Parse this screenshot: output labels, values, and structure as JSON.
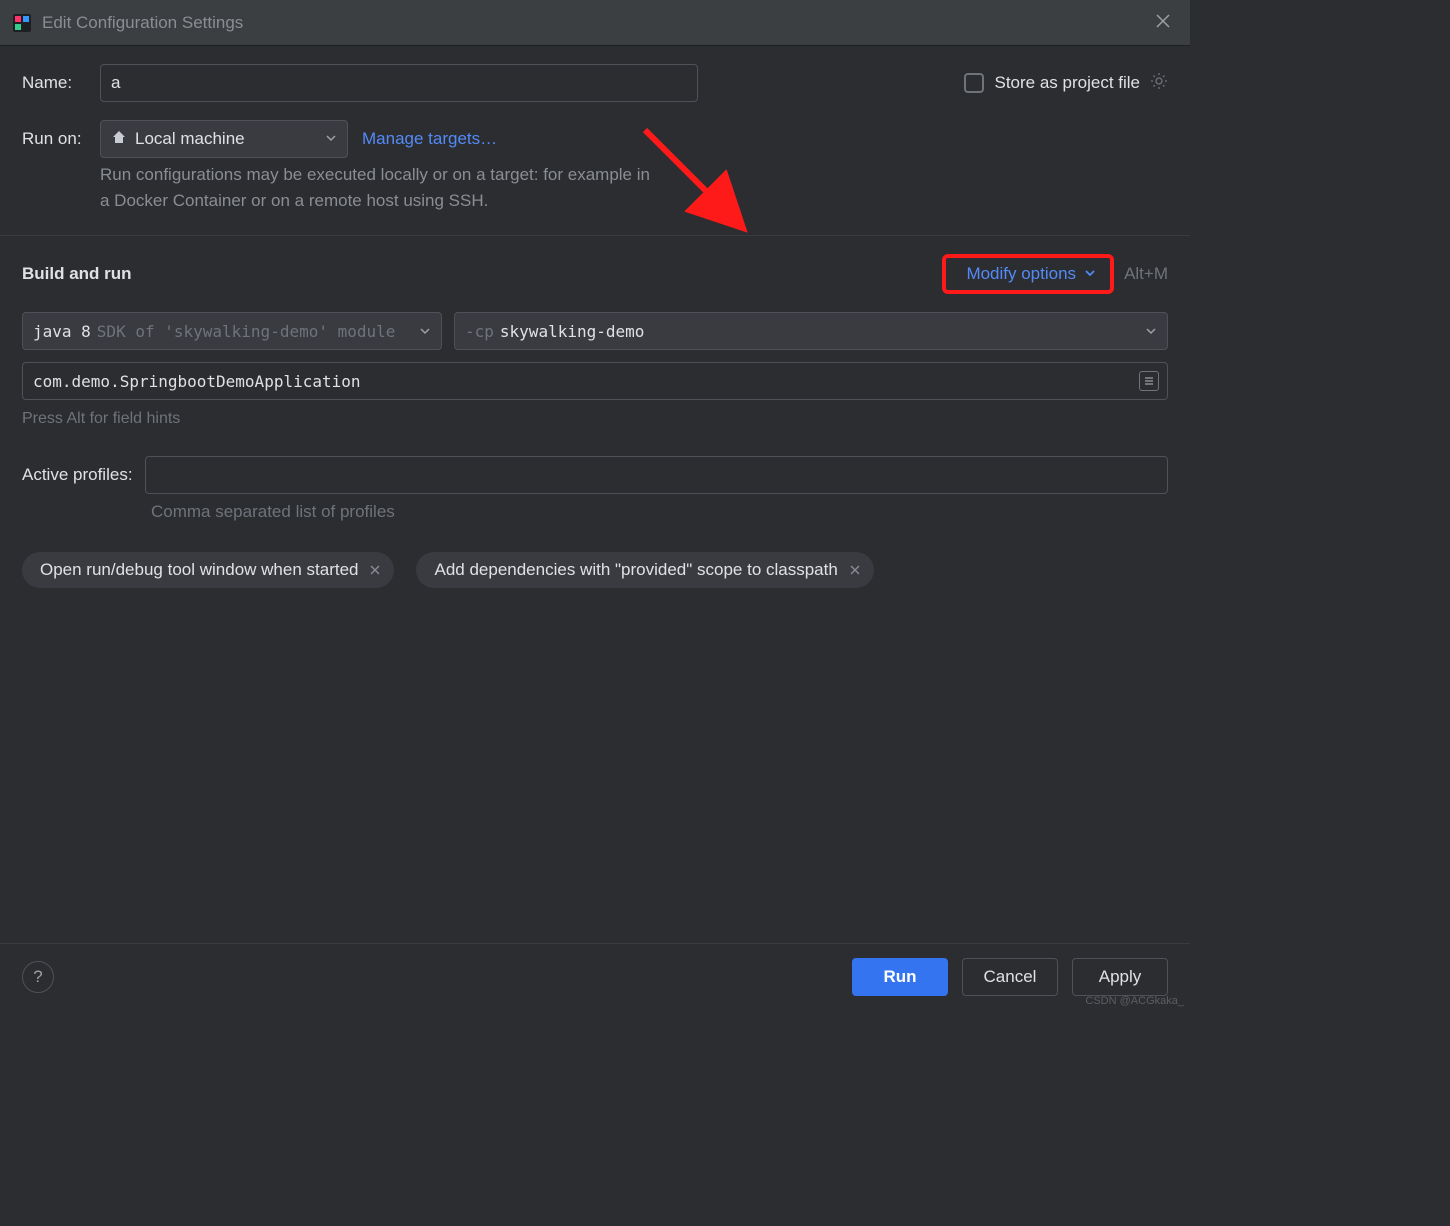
{
  "titlebar": {
    "title": "Edit Configuration Settings"
  },
  "name": {
    "label": "Name:",
    "value": "a"
  },
  "store": {
    "label": "Store as project file",
    "checked": false
  },
  "runon": {
    "label": "Run on:",
    "selected": "Local machine",
    "manage_link": "Manage targets…",
    "hint": "Run configurations may be executed locally or on a target: for example in a Docker Container or on a remote host using SSH."
  },
  "build_run": {
    "section_title": "Build and run",
    "modify_label": "Modify options",
    "shortcut": "Alt+M",
    "sdk_main": "java 8",
    "sdk_sub": "SDK of 'skywalking-demo' module",
    "cp_flag": "-cp",
    "cp_value": "skywalking-demo",
    "main_class": "com.demo.SpringbootDemoApplication",
    "field_hint": "Press Alt for field hints"
  },
  "profiles": {
    "label": "Active profiles:",
    "value": "",
    "hint": "Comma separated list of profiles"
  },
  "tags": [
    "Open run/debug tool window when started",
    "Add dependencies with \"provided\" scope to classpath"
  ],
  "footer": {
    "run": "Run",
    "cancel": "Cancel",
    "apply": "Apply"
  },
  "watermark": "CSDN @ACGkaka_"
}
